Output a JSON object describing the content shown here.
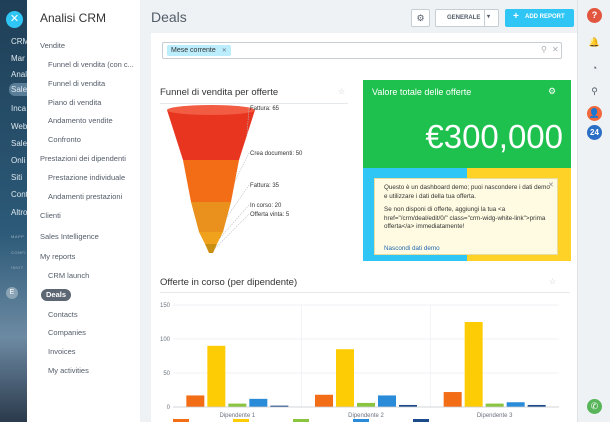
{
  "strip": {
    "items": [
      {
        "label": "CRM",
        "small": false
      },
      {
        "label": "Mar",
        "small": false
      },
      {
        "label": "Anal",
        "small": false
      },
      {
        "label": "Sale",
        "small": false
      },
      {
        "label": "Inca",
        "small": false
      },
      {
        "label": "Web",
        "small": false
      },
      {
        "label": "Sale",
        "small": false
      },
      {
        "label": "Onli",
        "small": false
      },
      {
        "label": "Siti",
        "small": false
      },
      {
        "label": "Cont",
        "small": false
      },
      {
        "label": "Altro",
        "small": false
      },
      {
        "label": "MAPP",
        "small": true
      },
      {
        "label": "CONFI",
        "small": true
      },
      {
        "label": "INVIT",
        "small": true
      }
    ],
    "avatar": "E"
  },
  "menu": {
    "title": "Analisi CRM",
    "items": [
      {
        "label": "Vendite",
        "type": "sec"
      },
      {
        "label": "Funnel di vendita (con c...",
        "type": "sub"
      },
      {
        "label": "Funnel di vendita",
        "type": "sub"
      },
      {
        "label": "Piano di vendita",
        "type": "sub"
      },
      {
        "label": "Andamento vendite",
        "type": "sub"
      },
      {
        "label": "Confronto",
        "type": "sub"
      },
      {
        "label": "Prestazioni dei dipendenti",
        "type": "sec"
      },
      {
        "label": "Prestazione individuale",
        "type": "sub"
      },
      {
        "label": "Andamenti prestazioni",
        "type": "sub"
      },
      {
        "label": "Clienti",
        "type": "sec"
      },
      {
        "label": "Sales Intelligence",
        "type": "sec"
      },
      {
        "label": "My reports",
        "type": "sec"
      },
      {
        "label": "CRM launch",
        "type": "sub"
      },
      {
        "label": "Deals",
        "type": "active"
      },
      {
        "label": "Contacts",
        "type": "sub"
      },
      {
        "label": "Companies",
        "type": "sub"
      },
      {
        "label": "Invoices",
        "type": "sub"
      },
      {
        "label": "My activities",
        "type": "sub"
      }
    ]
  },
  "header": {
    "title": "Deals",
    "preset_label": "GENERALE",
    "add_report_label": "ADD REPORT"
  },
  "filter": {
    "chip_label": "Mese corrente"
  },
  "funnel": {
    "title": "Funnel di vendita per offerte",
    "stages": [
      {
        "label": "Fattura: 65",
        "color": "#e8351f"
      },
      {
        "label": "Crea documenti: 50",
        "color": "#f36d17"
      },
      {
        "label": "Fattura: 35",
        "color": "#e9901d"
      },
      {
        "label": "In corso: 20",
        "color": "#f0a21d"
      },
      {
        "label": "Offerta vinta: 5",
        "color": "#c98f12"
      }
    ]
  },
  "total_widget": {
    "title": "Valore totale delle offerte",
    "value": "€300,000",
    "value2": "00",
    "color": "#1ec04e"
  },
  "demo_popup": {
    "text1": "Questo è un dashboard demo; puoi nascondere i dati demo e utilizzare i dati della tua offerta.",
    "text2": "Se non disponi di offerte, aggiungi la tua <a href=\"/crm/deal/edit/0/\" class=\"crm-widg-white-link\">prima offerta</a> immediatamente!",
    "link": "Nascondi dati demo"
  },
  "bar_widget": {
    "title": "Offerte in corso (per dipendente)"
  },
  "chart_data": {
    "type": "bar",
    "title": "Offerte in corso (per dipendente)",
    "categories": [
      "Dipendente 1",
      "Dipendente 2",
      "Dipendente 3"
    ],
    "series": [
      {
        "color": "#f36d17",
        "values": [
          17,
          18,
          22
        ]
      },
      {
        "color": "#fecc05",
        "values": [
          90,
          85,
          125
        ]
      },
      {
        "color": "#8bc43f",
        "values": [
          5,
          6,
          5
        ]
      },
      {
        "color": "#2a8bd8",
        "values": [
          12,
          17,
          7
        ]
      },
      {
        "color": "#1c4a8a",
        "values": [
          2,
          3,
          3
        ]
      }
    ],
    "ylim": [
      0,
      150
    ],
    "yticks": [
      0,
      50,
      100,
      150
    ],
    "grid": true
  },
  "rail": {
    "badge_count": "24"
  }
}
